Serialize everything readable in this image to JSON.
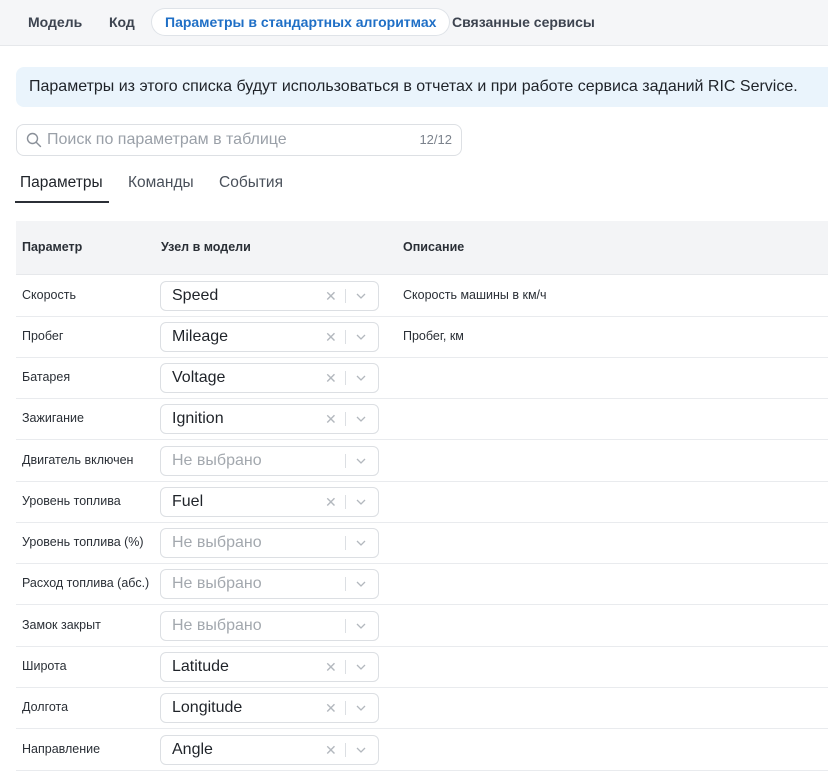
{
  "top_tabs": [
    {
      "label": "Модель"
    },
    {
      "label": "Код"
    },
    {
      "label": "Параметры в стандартных алгоритмах"
    },
    {
      "label": "Связанные сервисы"
    }
  ],
  "banner": {
    "text": "Параметры из этого списка будут использоваться в отчетах и при работе сервиса заданий RIC Service."
  },
  "search": {
    "placeholder": "Поиск по параметрам в таблице",
    "count": "12/12"
  },
  "sub_tabs": [
    {
      "label": "Параметры"
    },
    {
      "label": "Команды"
    },
    {
      "label": "События"
    }
  ],
  "table": {
    "headers": {
      "param": "Параметр",
      "node": "Узел в модели",
      "description": "Описание"
    },
    "rows": [
      {
        "param": "Скорость",
        "node": "Speed",
        "description": "Скорость машины в км/ч"
      },
      {
        "param": "Пробег",
        "node": "Mileage",
        "description": "Пробег, км"
      },
      {
        "param": "Батарея",
        "node": "Voltage",
        "description": ""
      },
      {
        "param": "Зажигание",
        "node": "Ignition",
        "description": ""
      },
      {
        "param": "Двигатель включен",
        "node": "Не выбрано",
        "description": ""
      },
      {
        "param": "Уровень топлива",
        "node": "Fuel",
        "description": ""
      },
      {
        "param": "Уровень топлива (%)",
        "node": "Не выбрано",
        "description": ""
      },
      {
        "param": "Расход топлива (абс.)",
        "node": "Не выбрано",
        "description": ""
      },
      {
        "param": "Замок закрыт",
        "node": "Не выбрано",
        "description": ""
      },
      {
        "param": "Широта",
        "node": "Latitude",
        "description": ""
      },
      {
        "param": "Долгота",
        "node": "Longitude",
        "description": ""
      },
      {
        "param": "Направление",
        "node": "Angle",
        "description": ""
      }
    ]
  },
  "colors": {
    "accent": "#1f6fc6",
    "banner_bg": "#eaf4fc",
    "header_bg": "#f3f4f6"
  },
  "icons": {
    "search": "search-icon",
    "clear": "close-icon",
    "dropdown": "chevron-down-icon"
  }
}
